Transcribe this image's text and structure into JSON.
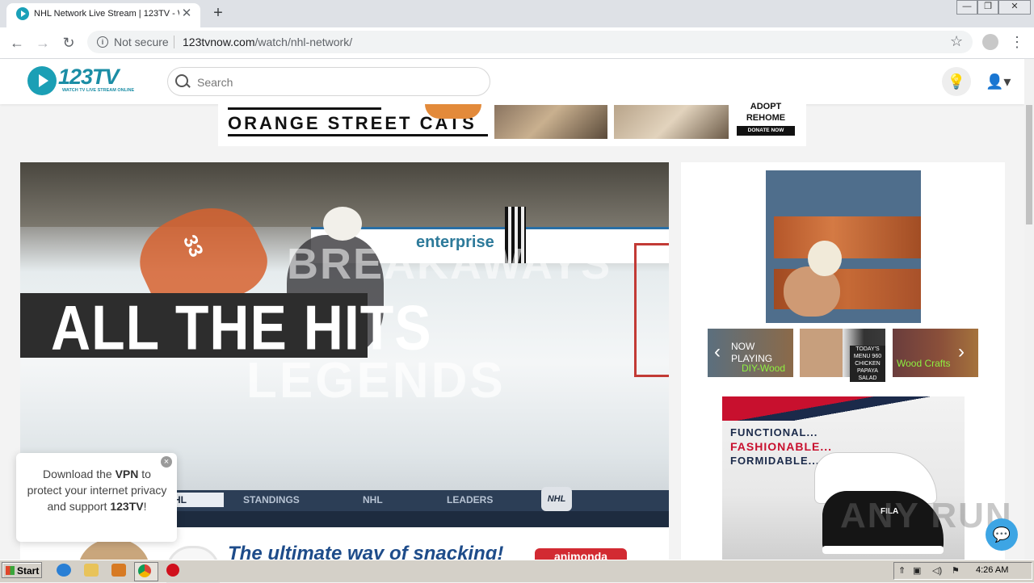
{
  "browser": {
    "tab_title": "NHL Network Live Stream | 123TV - W",
    "tab_close": "✕",
    "new_tab": "+",
    "security_label": "Not secure",
    "url_domain": "123tvnow.com",
    "url_path": "/watch/nhl-network/",
    "window_controls": [
      "—",
      "❐",
      "✕"
    ]
  },
  "site": {
    "logo_text": "123TV",
    "logo_tagline": "WATCH TV LIVE STREAM ONLINE",
    "search_placeholder": "Search"
  },
  "top_ad": {
    "headline": "ORANGE STREET CATS",
    "adopt_text": "ADOPT REHOME",
    "donate_label": "DONATE NOW"
  },
  "video": {
    "title_overlay": "ALL THE HITS",
    "ghost_top": "BREAKAWAYS",
    "ghost_bottom": "LEGENDS",
    "jersey_number": "33",
    "board_text": "enterprise",
    "lower_bar_items": [
      "HL",
      "STANDINGS",
      "NHL",
      "LEADERS"
    ],
    "nhl_logo": "NHL"
  },
  "sidebar": {
    "carousel": {
      "now_playing": "NOW PLAYING",
      "thumb1_label": "DIY-Wood",
      "thumb2_label": "TODAY'S MENU 960 CHICKEN PAPAYA SALAD",
      "thumb3_label": "Wood Crafts"
    },
    "fila_ad": {
      "line1": "FUNCTIONAL...",
      "line2": "FASHIONABLE...",
      "line3": "FORMIDABLE...",
      "brand": "FILA"
    }
  },
  "below_video_ad": {
    "headline": "The ultimate way of snacking!",
    "brand": "animonda"
  },
  "vpn_popup": {
    "text_before": "Download the ",
    "vpn_word": "VPN",
    "text_middle": " to protect your internet privacy and support ",
    "brand_word": "123TV",
    "text_after": "!",
    "close": "×"
  },
  "watermark": "ANY RUN",
  "taskbar": {
    "start_label": "Start",
    "clock": "4:26 AM"
  },
  "colors": {
    "brand": "#1b9fb5",
    "chat": "#3da5e4",
    "fila_red": "#c8102e"
  }
}
